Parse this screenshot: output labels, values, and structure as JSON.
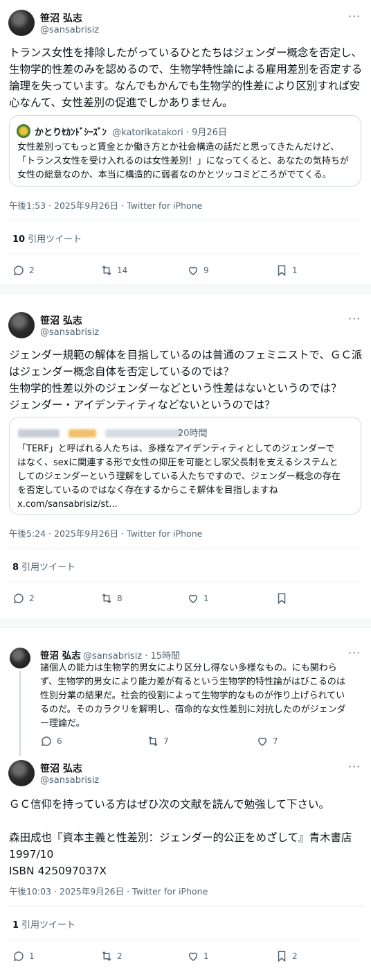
{
  "tweet1": {
    "name": "笹沼 弘志",
    "handle": "@sansabrisiz",
    "text": "トランス女性を排除したがっているひとたちはジェンダー概念を否定し、\n生物学的性差のみを認めるので、生物学特性論による雇用差別を否定する\n論理を失っています。なんでもかんでも生物学的性差により区別すれば安\n心なんて、女性差別の促進でしかありません。",
    "quote": {
      "name": "かとりｾｶﾝﾄﾞｼｰｽﾞﾝ",
      "handle_date": "@katorikatakori · 9月26日",
      "text": "女性差別ってもっと賃金とか働き方とか社会構造の話だと思ってきたんだけど、\n「トランス女性を受け入れるのは女性差別！」になってくると、あなたの気持ちが\n女性の総意なのか、本当に構造的に弱者なのかとツッコミどころがでてくる。"
    },
    "meta": "午後1:53 · 2025年9月26日 · Twitter for iPhone",
    "quote_count": "10",
    "quote_label": "引用ツイート",
    "replies": "2",
    "retweets": "14",
    "likes": "9",
    "bookmarks": "1"
  },
  "tweet2": {
    "name": "笹沼 弘志",
    "handle": "@sansabrisiz",
    "text": "ジェンダー規範の解体を目指しているのは普通のフェミニストで、ＧＣ派\nはジェンダー概念自体を否定しているのでは？\n生物学的性差以外のジェンダーなどという性差はないというのでは？\nジェンダー・アイデンティティなどないというのでは？",
    "quote": {
      "time": "20時間",
      "text": "「TERF」と呼ばれる人たちは、多様なアイデンティティとしてのジェンダーで\nはなく、sexに関連する形で女性の抑圧を可能とし家父長制を支えるシステムと\nしてのジェンダーという理解をしている人たちですので、ジェンダー概念の存在\nを否定しているのではなく存在するからこそ解体を目指しますね\nx.com/sansabrisiz/st..."
    },
    "meta": "午後5:24 · 2025年9月26日 · Twitter for iPhone",
    "quote_count": "8",
    "quote_label": "引用ツイート",
    "replies": "2",
    "retweets": "8",
    "likes": "1"
  },
  "tweet3a": {
    "name": "笹沼 弘志",
    "handle_time": "@sansabrisiz · 15時間",
    "text": "諸個人の能力は生物学的男女により区分し得ない多様なもの。にも関わら\nず、生物学的男女により能力差が有るという生物学的特性論がはびこるのは\n性別分業の結果だ。社会的役割によって生物学的なものが作り上げられてい\nるのだ。そのカラクリを解明し、宿命的な女性差別に対抗したのがジェンダ\nー理論だ。",
    "replies": "6",
    "retweets": "7",
    "likes": "7"
  },
  "tweet3b": {
    "name": "笹沼 弘志",
    "handle": "@sansabrisiz",
    "text": "ＧＣ信仰を持っている方はぜひ次の文献を読んで勉強して下さい。\n\n森田成也『資本主義と性差別：ジェンダー的公正をめざして』青木書店\n1997/10\nISBN 425097037X",
    "meta": "午後10:03 · 2025年9月26日 · Twitter for iPhone",
    "quote_count": "1",
    "quote_label": "引用ツイート",
    "replies": "1",
    "retweets": "2",
    "likes": "1",
    "bookmarks": "2"
  },
  "more_label": "···",
  "colors": {
    "text": "#0f1419",
    "muted": "#536471",
    "border": "#cfd9de"
  }
}
